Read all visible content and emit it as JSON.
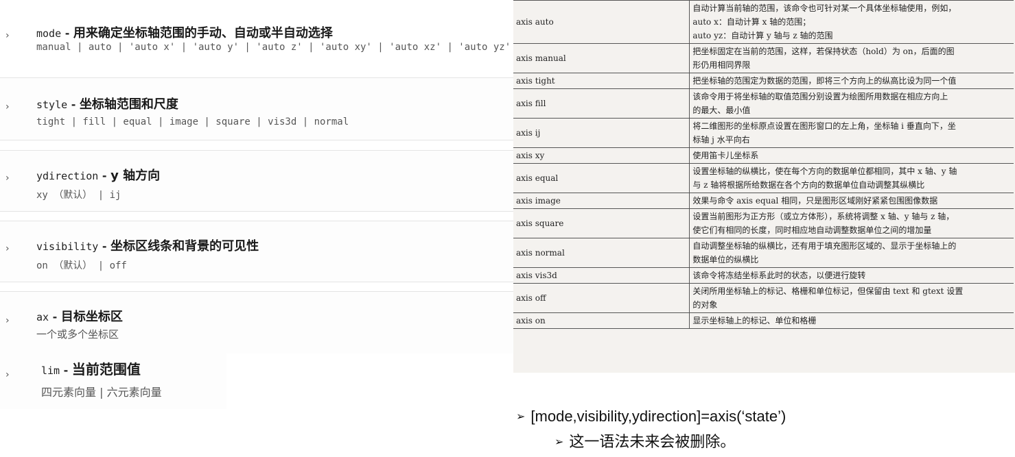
{
  "arguments": [
    {
      "name": "mode",
      "sep": " - ",
      "desc": "用来确定坐标轴范围的手动、自动或半自动选择",
      "values": "manual | auto | 'auto x' | 'auto y' | 'auto z' | 'auto xy' | 'auto xz' | 'auto yz'"
    },
    {
      "name": "style",
      "sep": " - ",
      "desc": "坐标轴范围和尺度",
      "values": "tight | fill | equal | image | square | vis3d | normal"
    },
    {
      "name": "ydirection",
      "sep": " - ",
      "desc": "y 轴方向",
      "values": "xy （默认） | ij"
    },
    {
      "name": "visibility",
      "sep": " - ",
      "desc": "坐标区线条和背景的可见性",
      "values": "on （默认） | off"
    },
    {
      "name": "ax",
      "sep": " - ",
      "desc": "目标坐标区",
      "values": "一个或多个坐标区"
    },
    {
      "name": "lim",
      "sep": " - ",
      "desc": "当前范围值",
      "values": "四元素向量 | 六元素向量"
    }
  ],
  "table": {
    "rows": [
      {
        "cmd": "axis auto",
        "lines": [
          "自动计算当前轴的范围，该命令也可针对某一个具体坐标轴使用，例如，",
          "auto x：自动计算 x 轴的范围；",
          "auto yz：自动计算 y 轴与 z 轴的范围"
        ]
      },
      {
        "cmd": "axis manual",
        "lines": [
          "把坐标固定在当前的范围，这样，若保持状态（hold）为 on，后面的图",
          "形仍用相同界限"
        ]
      },
      {
        "cmd": "axis tight",
        "lines": [
          "把坐标轴的范围定为数据的范围，即将三个方向上的纵高比设为同一个值"
        ]
      },
      {
        "cmd": "axis fill",
        "lines": [
          "该命令用于将坐标轴的取值范围分别设置为绘图所用数据在相应方向上",
          "的最大、最小值"
        ]
      },
      {
        "cmd": "axis ij",
        "lines": [
          "将二维图形的坐标原点设置在图形窗口的左上角，坐标轴 i 垂直向下，坐",
          "标轴 j 水平向右"
        ]
      },
      {
        "cmd": "axis xy",
        "lines": [
          "使用笛卡儿坐标系"
        ]
      },
      {
        "cmd": "axis equal",
        "lines": [
          "设置坐标轴的纵横比，使在每个方向的数据单位都相同，其中 x 轴、y 轴",
          "与 z 轴将根据所给数据在各个方向的数据单位自动调整其纵横比"
        ]
      },
      {
        "cmd": "axis image",
        "lines": [
          "效果与命令 axis equal 相同，只是图形区域刚好紧紧包围图像数据"
        ]
      },
      {
        "cmd": "axis square",
        "lines": [
          "设置当前图形为正方形（或立方体形），系统将调整 x 轴、y 轴与 z 轴，",
          "使它们有相同的长度，同时相应地自动调整数据单位之间的增加量"
        ]
      },
      {
        "cmd": "axis normal",
        "lines": [
          "自动调整坐标轴的纵横比，还有用于填充图形区域的、显示于坐标轴上的",
          "数据单位的纵横比"
        ]
      },
      {
        "cmd": "axis vis3d",
        "lines": [
          "该命令将冻结坐标系此时的状态，以便进行旋转"
        ]
      },
      {
        "cmd": "axis off",
        "lines": [
          "关闭所用坐标轴上的标记、格栅和单位标记，但保留由 text 和 gtext 设置",
          "的对象"
        ]
      },
      {
        "cmd": "axis on",
        "lines": [
          "显示坐标轴上的标记、单位和格栅"
        ]
      }
    ]
  },
  "bullets": {
    "arrow": "➢",
    "b1": "[mode,visibility,ydirection]=axis(‘state’)",
    "b2": "这一语法未来会被删除。"
  },
  "colors": {
    "chevron": "#555555",
    "text": "#222222",
    "values": "#555555",
    "table_bg": "#f4f2ef"
  }
}
